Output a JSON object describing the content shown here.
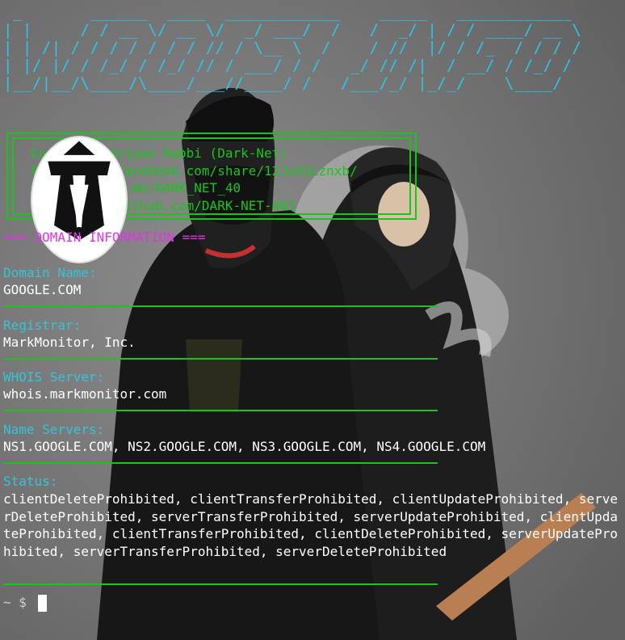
{
  "banner": {
    "lines": [
      " _       ______  ____  ____________    _____   ____________",
      "| |     / / __ \\/ __ \\/  _/ ___/  /   /  _/ | / / ____/ __ \\",
      "| | /| / / / / / / / // / \\__ \\  /    / //  |/ / /_  / / / /",
      "| |/ |/ / /_/ / /_/ // / ___/ / /   _/ // /|  / __/ / /_/ /",
      "|__/|__/\\____/\\____/___//____/ /   /___/_/ |_/_/    \\____/"
    ],
    "color": "#2ec5e8"
  },
  "credits": {
    "coded_by": "Coded by: Ariyan Rabbi (Dark-Net)",
    "facebook": "Facebook : facebook.com/share/12Ju91Lznxb/",
    "telegram": "Telegram : t.me/DARK_NET_40",
    "github": "GitHub   : github.com/DARK-NET-403",
    "color": "#19c51d"
  },
  "section_header": "=== DOMAIN INFORMATION ===",
  "fields": {
    "domain_name": {
      "label": "Domain Name:",
      "value": "GOOGLE.COM"
    },
    "registrar": {
      "label": "Registrar:",
      "value": "MarkMonitor, Inc."
    },
    "whois_server": {
      "label": "WHOIS Server:",
      "value": "whois.markmonitor.com"
    },
    "name_servers": {
      "label": "Name Servers:",
      "value": "NS1.GOOGLE.COM, NS2.GOOGLE.COM, NS3.GOOGLE.COM, NS4.GOOGLE.COM"
    },
    "status": {
      "label": "Status:",
      "value": "clientDeleteProhibited, clientTransferProhibited, clientUpdateProhibited, serverDeleteProhibited, serverTransferProhibited, serverUpdateProhibited, clientUpdateProhibited, clientTransferProhibited, clientDeleteProhibited, serverUpdateProhibited, serverTransferProhibited, serverDeleteProhibited"
    }
  },
  "prompt": "~ $",
  "colors": {
    "label": "#34c4d8",
    "value": "#ffffff",
    "header": "#e233e8",
    "separator": "#19c51d"
  },
  "icons": {
    "avatar": "dark-net-logo-icon",
    "wallpaper": "hooded-figures-wallpaper"
  }
}
